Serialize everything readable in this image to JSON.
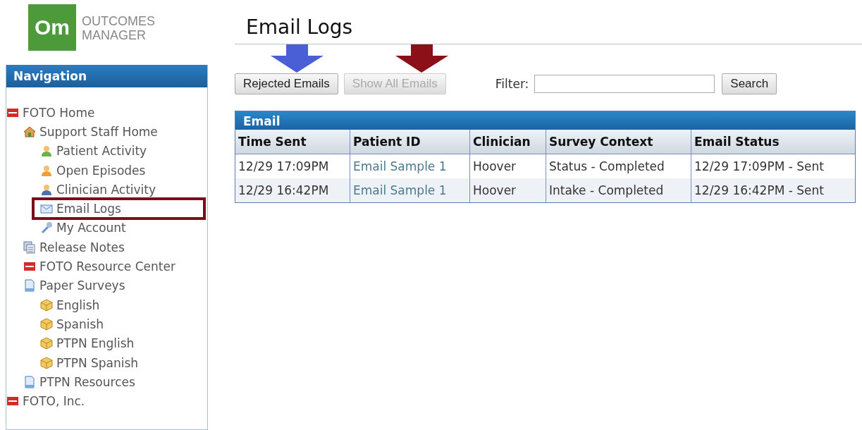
{
  "logo": {
    "mark": "Om",
    "line1": "OUTCOMES",
    "line2": "MANAGER"
  },
  "navigation": {
    "title": "Navigation",
    "items": [
      {
        "label": "FOTO Home",
        "kind": "foto",
        "selected": false,
        "children": [
          {
            "label": "Support Staff Home",
            "kind": "house",
            "selected": false,
            "children": [
              {
                "label": "Patient Activity",
                "kind": "person-green",
                "selected": false
              },
              {
                "label": "Open Episodes",
                "kind": "person-orange",
                "selected": false
              },
              {
                "label": "Clinician Activity",
                "kind": "person-blue",
                "selected": false
              },
              {
                "label": "Email Logs",
                "kind": "envelope",
                "selected": true
              },
              {
                "label": "My Account",
                "kind": "key",
                "selected": false
              }
            ]
          },
          {
            "label": "Release Notes",
            "kind": "pages",
            "selected": false
          },
          {
            "label": "FOTO Resource Center",
            "kind": "foto",
            "selected": false
          },
          {
            "label": "Paper Surveys",
            "kind": "document",
            "selected": false,
            "children": [
              {
                "label": "English",
                "kind": "box",
                "selected": false
              },
              {
                "label": "Spanish",
                "kind": "box",
                "selected": false
              },
              {
                "label": "PTPN English",
                "kind": "box",
                "selected": false
              },
              {
                "label": "PTPN Spanish",
                "kind": "box",
                "selected": false
              }
            ]
          },
          {
            "label": "PTPN Resources",
            "kind": "document",
            "selected": false
          }
        ]
      },
      {
        "label": "FOTO, Inc.",
        "kind": "foto",
        "selected": false
      }
    ]
  },
  "page_title": "Email Logs",
  "toolbar": {
    "buttons": [
      {
        "label": "Rejected Emails",
        "disabled": false,
        "color": "#4a5fd6"
      },
      {
        "label": "Show All Emails",
        "disabled": true,
        "color": "#8c1018"
      }
    ],
    "filter_label": "Filter:",
    "search_button": "Search"
  },
  "table": {
    "title": "Email",
    "columns": [
      "Time Sent",
      "Patient ID",
      "Clinician",
      "Survey Context",
      "Email Status"
    ],
    "rows": [
      [
        "12/29 17:09PM",
        "Email Sample 1",
        "Hoover",
        "Status - Completed",
        "12/29 17:09PM - Sent"
      ],
      [
        "12/29 16:42PM",
        "Email Sample 1",
        "Hoover",
        "Intake - Completed",
        "12/29 16:42PM - Sent"
      ]
    ]
  }
}
